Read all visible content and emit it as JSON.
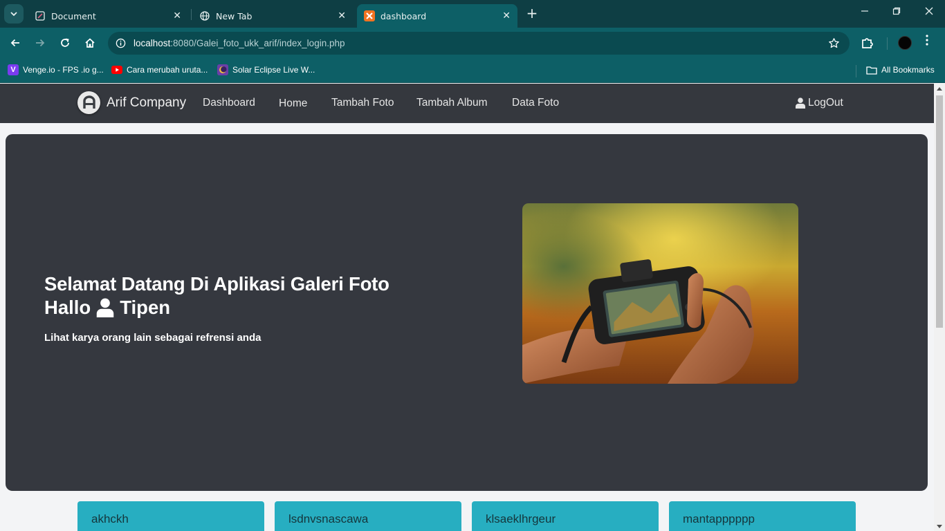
{
  "browser": {
    "tabs": [
      {
        "title": "Document",
        "icon": "document-favicon"
      },
      {
        "title": "New Tab",
        "icon": "globe-favicon"
      },
      {
        "title": "dashboard",
        "icon": "xampp-favicon",
        "active": true
      }
    ],
    "url_host": "localhost",
    "url_path": ":8080/Galei_foto_ukk_arif/index_login.php",
    "bookmarks": [
      {
        "label": "Venge.io - FPS .io g...",
        "icon": "venge-icon"
      },
      {
        "label": "Cara merubah uruta...",
        "icon": "youtube-icon"
      },
      {
        "label": "Solar Eclipse Live W...",
        "icon": "solar-eclipse-icon"
      }
    ],
    "all_bookmarks_label": "All Bookmarks"
  },
  "site": {
    "brand": "Arif Company",
    "nav": [
      "Dashboard",
      "Home",
      "Tambah Foto",
      "Tambah Album",
      "Data Foto"
    ],
    "logout": "LogOut"
  },
  "hero": {
    "title": "Selamat Datang Di Aplikasi Galeri Foto",
    "hello": "Hallo",
    "username": "Tipen",
    "subtitle": "Lihat karya orang lain sebagai refrensi anda"
  },
  "albums": [
    "akhckh",
    "lsdnvsnascawa",
    "klsaeklhrgeur",
    "mantapppppp"
  ],
  "colors": {
    "tab_bar": "#0e3e44",
    "toolbar": "#0d5f66",
    "site_nav": "#35383e",
    "hero_bg": "#35383f",
    "album_card": "#27aec1"
  }
}
